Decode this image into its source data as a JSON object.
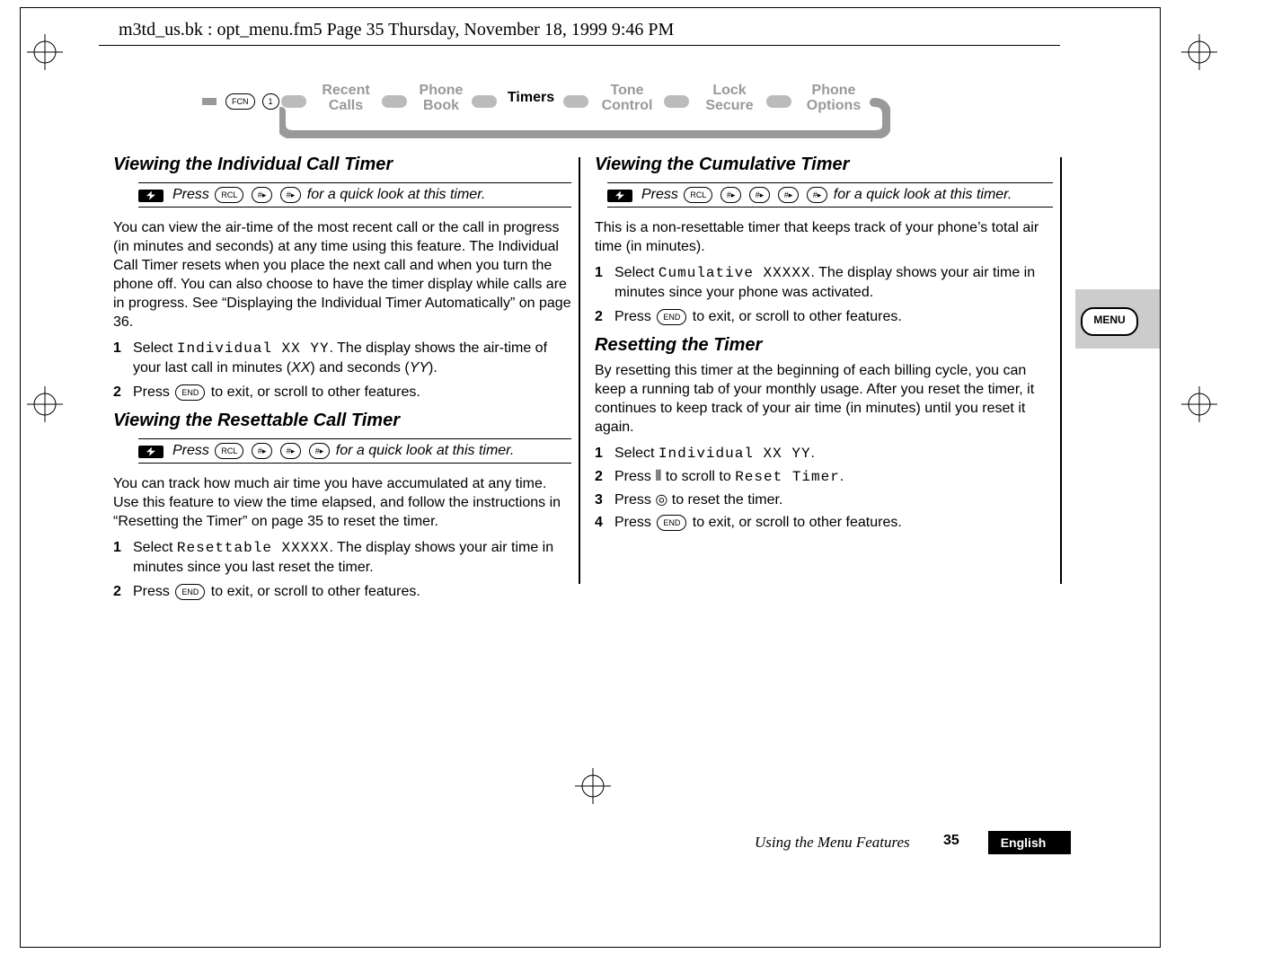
{
  "pathline": "m3td_us.bk : opt_menu.fm5  Page 35  Thursday, November 18, 1999  9:46 PM",
  "nav": {
    "fcn": "FCN",
    "one": "1",
    "recent": "Recent\nCalls",
    "phonebook": "Phone\nBook",
    "timers": "Timers",
    "tone": "Tone\nControl",
    "lock": "Lock\nSecure",
    "options": "Phone\nOptions"
  },
  "left": {
    "h1": "Viewing the Individual Call Timer",
    "tip1_pre": "Press ",
    "tip1_k1": "RCL",
    "tip1_k2": "#▸",
    "tip1_k3": "#▸",
    "tip1_post": " for a quick look at this timer.",
    "para1": "You can view the air-time of the most recent call or the call in progress (in minutes and seconds) at any time using this feature. The Individual Call Timer resets when you place the next call and when you turn the phone off. You can also choose to have the timer display while calls are in progress. See “Displaying the Individual Timer Automatically” on page 36.",
    "l1n": "1",
    "l1_a": "Select ",
    "l1_code": "Individual XX YY",
    "l1_b": ". The display shows the air-time of your last call in minutes (",
    "l1_xx": "XX",
    "l1_c": ") and seconds (",
    "l1_yy": "YY",
    "l1_d": ").",
    "l2n": "2",
    "l2_a": "Press ",
    "l2_key": "END",
    "l2_b": " to exit, or scroll to other features.",
    "h2": "Viewing the Resettable Call Timer",
    "tip2_pre": "Press ",
    "tip2_k1": "RCL",
    "tip2_k2": "#▸",
    "tip2_k3": "#▸",
    "tip2_k4": "#▸",
    "tip2_post": " for a quick look at this timer.",
    "para2": "You can track how much air time you have accumulated at any time. Use this feature to view the time elapsed, and follow the instructions in “Resetting the Timer” on page 35 to reset the timer.",
    "r1n": "1",
    "r1_a": "Select ",
    "r1_code": "Resettable XXXXX",
    "r1_b": ". The display shows your air time in minutes since you last reset the timer.",
    "r2n": "2",
    "r2_a": "Press ",
    "r2_key": "END",
    "r2_b": " to exit, or scroll to other features."
  },
  "right": {
    "h1": "Viewing the Cumulative Timer",
    "tip1_pre": "Press ",
    "tip1_k1": "RCL",
    "tip1_k2": "#▸",
    "tip1_k3": "#▸",
    "tip1_k4": "#▸",
    "tip1_k5": "#▸",
    "tip1_post": " for a quick look at this timer.",
    "para1": "This is a non-resettable timer that keeps track of your phone’s total air time (in minutes).",
    "c1n": "1",
    "c1_a": "Select ",
    "c1_code": "Cumulative XXXXX",
    "c1_b": ". The display shows your air time in minutes since your phone was activated.",
    "c2n": "2",
    "c2_a": "Press ",
    "c2_key": "END",
    "c2_b": " to exit, or scroll to other features.",
    "h2": "Resetting the Timer",
    "para2": "By resetting this timer at the beginning of each billing cycle, you can keep a running tab of your monthly usage. After you reset the timer, it continues to keep track of your air time (in minutes) until you reset it again.",
    "s1n": "1",
    "s1_a": "Select ",
    "s1_code": "Individual XX YY",
    "s1_b": ".",
    "s2n": "2",
    "s2_a": "Press ",
    "s2_glyph": "⦀",
    "s2_b": " to scroll to ",
    "s2_code": "Reset Timer",
    "s2_c": ".",
    "s3n": "3",
    "s3_a": "Press ",
    "s3_glyph": "◎",
    "s3_b": " to reset the timer.",
    "s4n": "4",
    "s4_a": "Press ",
    "s4_key": "END",
    "s4_b": " to exit, or scroll to other features."
  },
  "footer": {
    "section": "Using the Menu Features",
    "page": "35",
    "lang": "English"
  },
  "menu_badge": "MENU"
}
